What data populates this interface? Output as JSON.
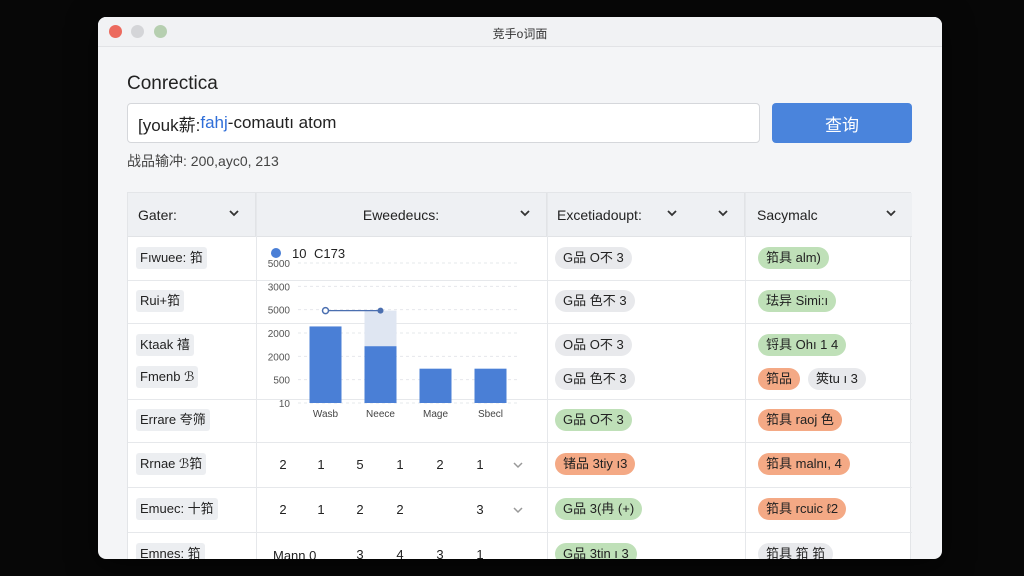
{
  "window": {
    "title": "竞手o词面"
  },
  "app": {
    "heading": "Conrectica"
  },
  "search": {
    "prefix": "[youk薪: ",
    "highlight": "fahj",
    "suffix": "-comautı atom"
  },
  "query_button": {
    "label": "查询"
  },
  "meta": {
    "text": "战品输冲: 200,ayc0, 213"
  },
  "columns": [
    {
      "label": "Gater:"
    },
    {
      "label": "Eweedeucs:"
    },
    {
      "label": "Excetiadoupt:"
    },
    {
      "label": "Sacymalc"
    }
  ],
  "rows": {
    "r1": {
      "label": "Fıwuee: 筘",
      "col3": "G品 O不 3",
      "col4": "筘具 alm)"
    },
    "r2": {
      "label": "Rui+筘",
      "col3": "G品 色不 3",
      "col4": "珐异 Simi:ı"
    },
    "r3": {
      "label": "Ktaak 禧",
      "col3": "O品 O不 3",
      "col4": "锊具 Ohı 1 4"
    },
    "r4": {
      "label": "Fmenb ℬ",
      "col3": "G品 色不 3",
      "col4a": "筘品",
      "col4b": "筴tu ı 3"
    },
    "r5": {
      "label": "Errare 夸筛",
      "col3": "G品 O不 3",
      "col4": "筘具 raoj 色"
    },
    "r6": {
      "label": "Rrnae ℬ筘",
      "nums": [
        "2",
        "1",
        "5",
        "1",
        "2",
        "1"
      ],
      "col3": "锗品 3tiy ı3",
      "col4": "筘具 malnı, 4"
    },
    "r7": {
      "label": "Emuec: 十筘",
      "nums": [
        "2",
        "1",
        "2",
        "2",
        "3"
      ],
      "col3": "G品 3(冉 (+)",
      "col4": "筘具 rcuic ℓ2"
    },
    "r8": {
      "label": "Emnes: 筘",
      "nums": [
        "Mann 0",
        "3",
        "4",
        "3",
        "1"
      ],
      "col3": "G品 3tin ı 3",
      "col4": "筘具 筘 筘"
    }
  },
  "chart_data": {
    "type": "bar",
    "legend": {
      "marker_label": "10",
      "series_label": "C173"
    },
    "categories": [
      "Wasb",
      "Neece",
      "Mage",
      "Sbecl"
    ],
    "values": [
      5800,
      4300,
      2600,
      2600
    ],
    "highlight_values": [
      null,
      7000,
      null,
      null
    ],
    "line_points": [
      7000,
      7000
    ],
    "yticks": [
      "10",
      "500",
      "2000",
      "2000",
      "5000",
      "3000",
      "5000"
    ],
    "ylim": [
      0,
      10000
    ],
    "colors": {
      "bar": "#4a7fd6",
      "highlight": "#dfe6f2",
      "line": "#4b6fb0"
    }
  },
  "icons": {
    "caret": "chevron-down-icon",
    "legend": "legend-dot-icon"
  },
  "colors": {
    "accent": "#4a84dc",
    "pill_green": "#bfe0b8",
    "pill_orange": "#f4a985",
    "pill_gray": "#e8e9ec"
  }
}
